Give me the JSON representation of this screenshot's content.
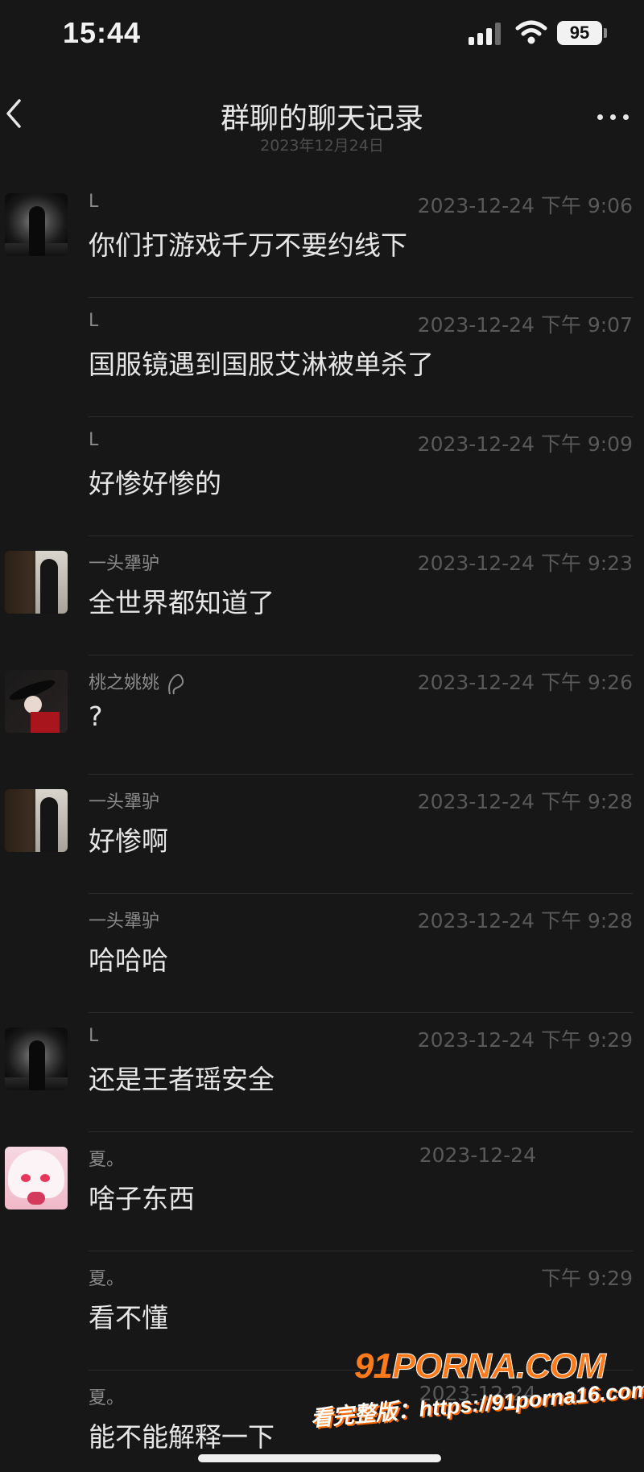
{
  "status_bar": {
    "time": "15:44",
    "battery": "95"
  },
  "header": {
    "title": "群聊的聊天记录",
    "subtitle": "2023年12月24日"
  },
  "messages": [
    {
      "sender": "L",
      "timestamp": "2023-12-24 下午 9:06",
      "text": "你们打游戏千万不要约线下",
      "avatar": "l-avatar"
    },
    {
      "sender": "L",
      "timestamp": "2023-12-24 下午 9:07",
      "text": "国服镜遇到国服艾淋被单杀了",
      "avatar": ""
    },
    {
      "sender": "L",
      "timestamp": "2023-12-24 下午 9:09",
      "text": "好惨好惨的",
      "avatar": ""
    },
    {
      "sender": "一头犟驴",
      "timestamp": "2023-12-24 下午 9:23",
      "text": "全世界都知道了",
      "avatar": "donkey-avatar"
    },
    {
      "sender": "桃之姚姚",
      "timestamp": "2023-12-24 下午 9:26",
      "text": "?",
      "avatar": "tao-avatar",
      "symbol": "scorpio-symbol-icon"
    },
    {
      "sender": "一头犟驴",
      "timestamp": "2023-12-24 下午 9:28",
      "text": "好惨啊",
      "avatar": "donkey-avatar"
    },
    {
      "sender": "一头犟驴",
      "timestamp": "2023-12-24 下午 9:28",
      "text": "哈哈哈",
      "avatar": ""
    },
    {
      "sender": "L",
      "timestamp": "2023-12-24 下午 9:29",
      "text": "还是王者瑶安全",
      "avatar": "l-avatar"
    },
    {
      "sender": "夏。",
      "timestamp": "2023-12-24",
      "text": "啥子东西",
      "avatar": "xia-avatar"
    },
    {
      "sender": "夏。",
      "timestamp": "下午 9:29",
      "text": "看不懂",
      "avatar": ""
    },
    {
      "sender": "夏。",
      "timestamp": "2023-12-24",
      "text": "能不能解释一下",
      "avatar": ""
    }
  ],
  "watermark": {
    "logo_num": "91",
    "logo_text": "PORNA.COM",
    "url": "看完整版：https://91porna16.com"
  },
  "colors": {
    "background": "#171717",
    "text": "#e6e6e6",
    "sender": "#8a8a8a",
    "timestamp": "#595959",
    "watermark_accent": "#ff7a1a"
  },
  "icons": {
    "back": "chevron-left-icon",
    "more": "more-dots-icon",
    "signal": "signal-icon",
    "wifi": "wifi-icon",
    "battery": "battery-icon"
  }
}
